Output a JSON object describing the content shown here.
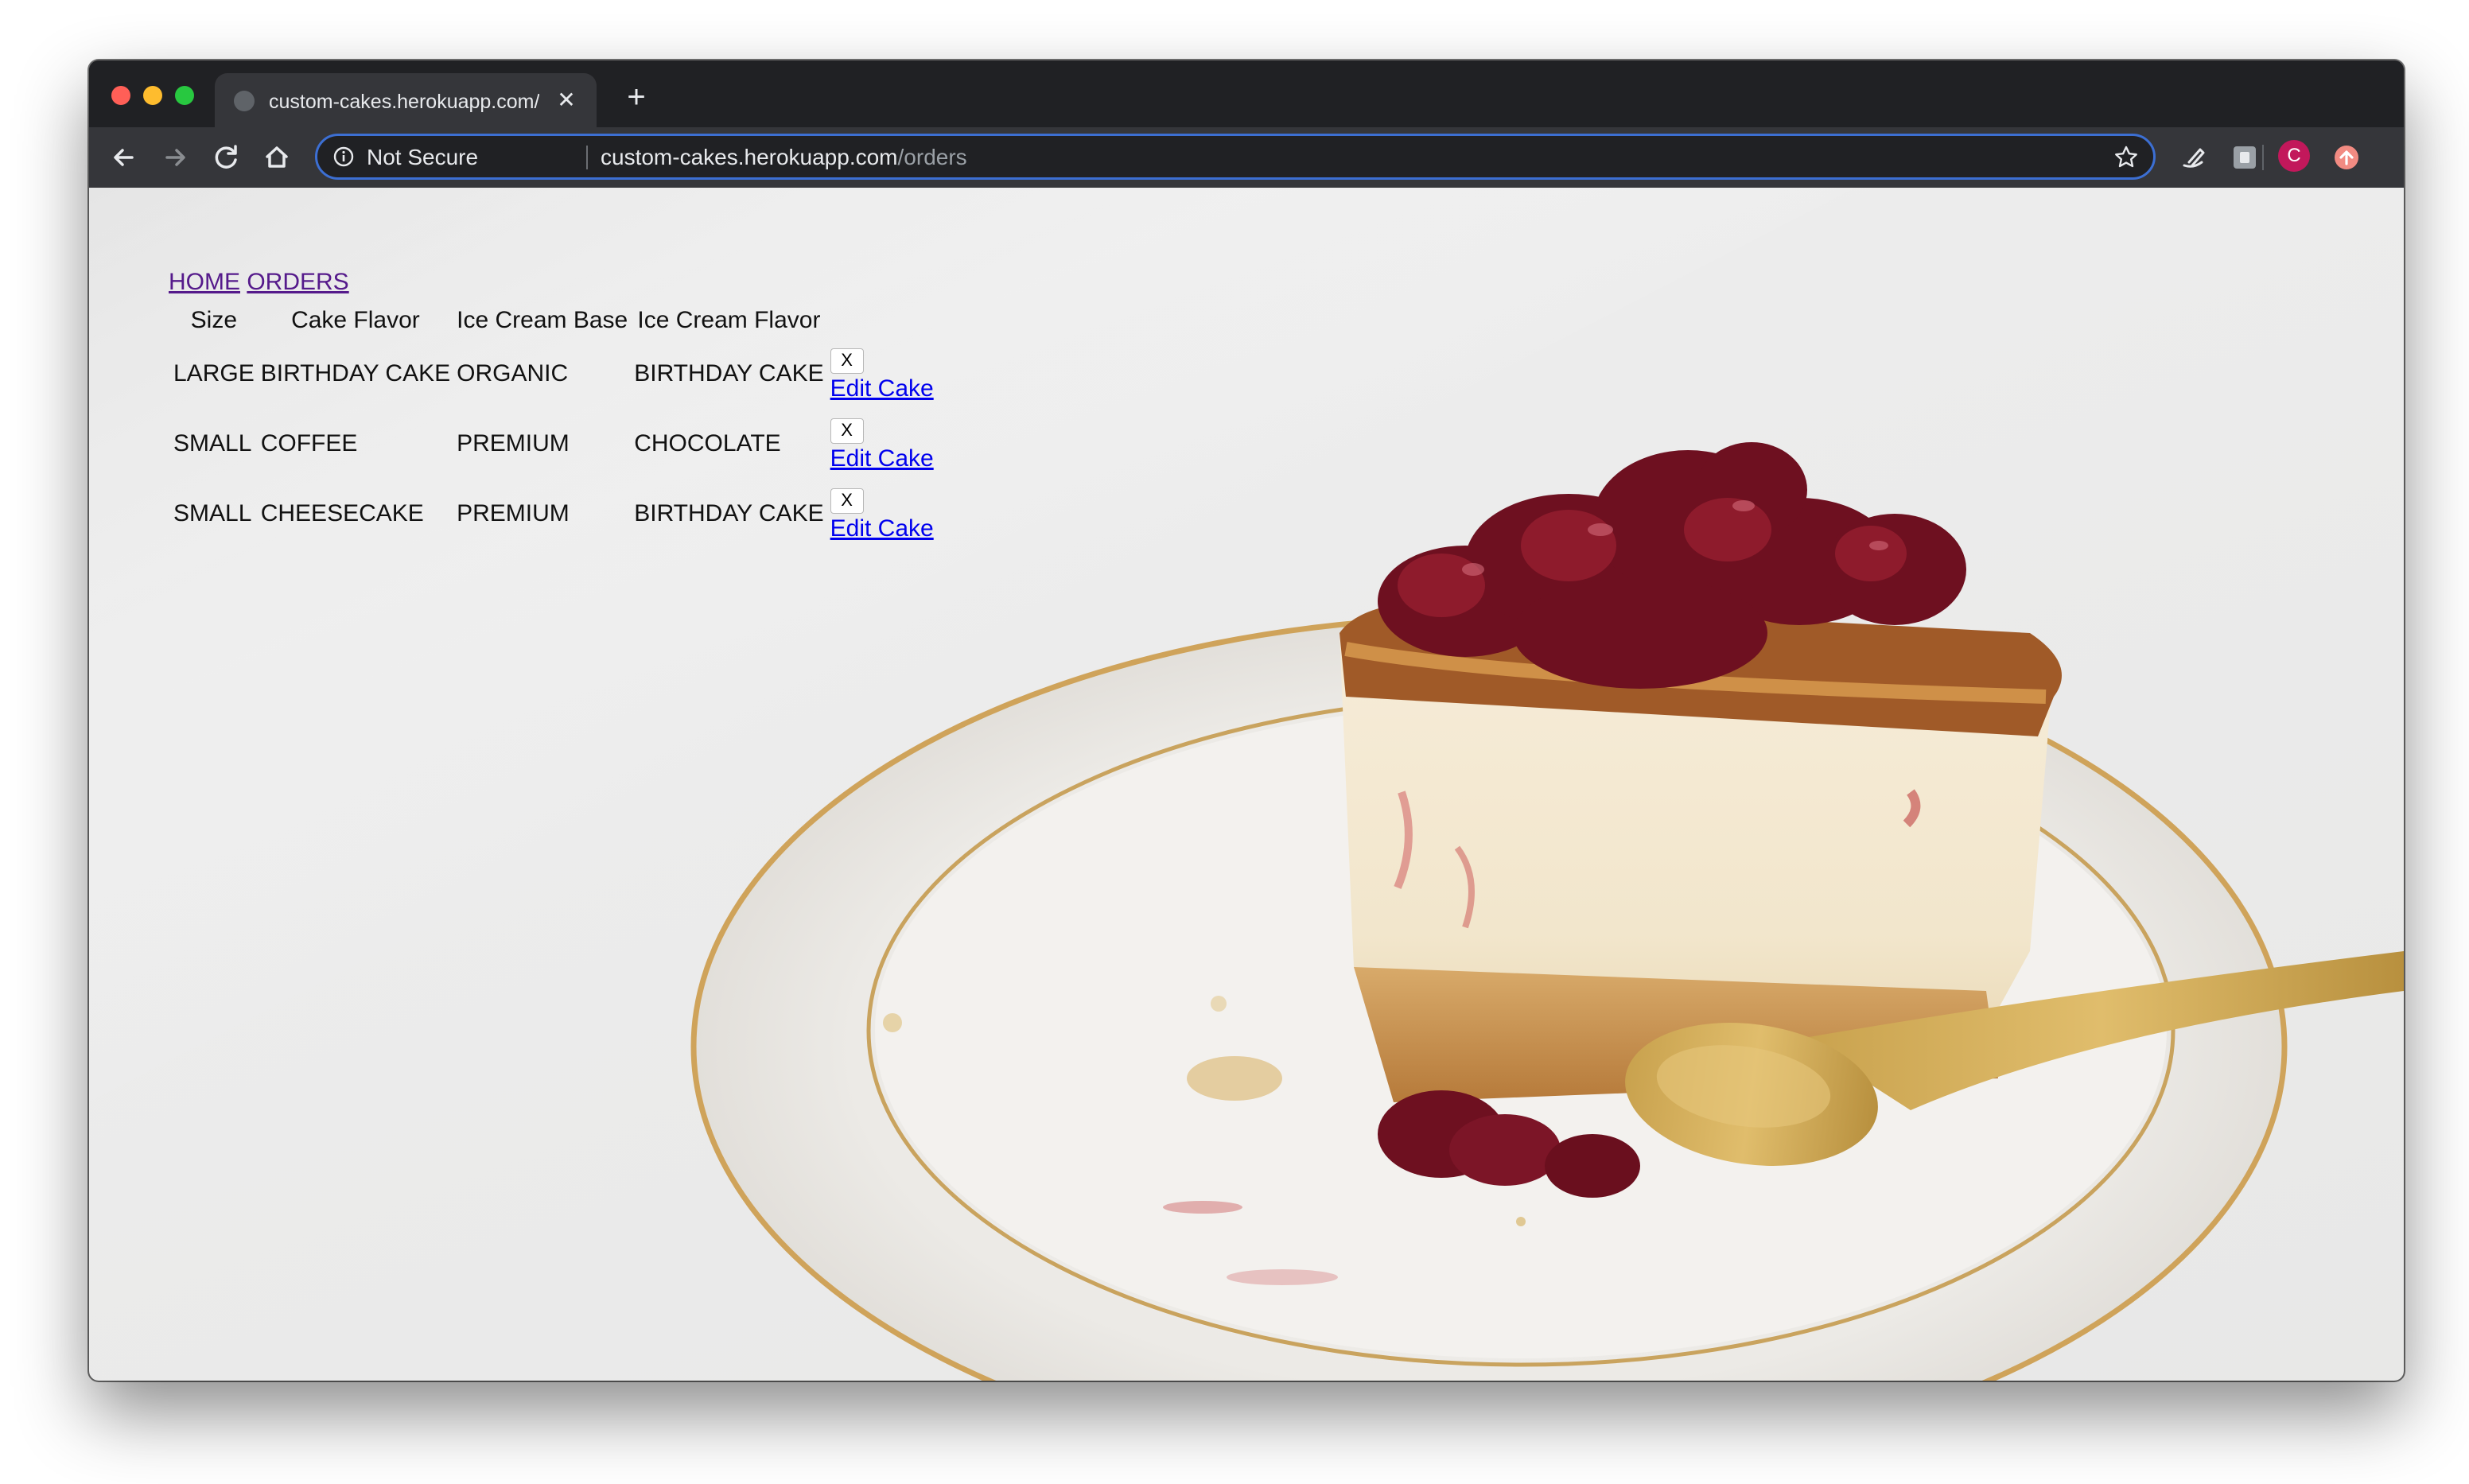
{
  "browser": {
    "tab_title": "custom-cakes.herokuapp.com/",
    "tab_close": "✕",
    "new_tab": "+",
    "security_label": "Not Secure",
    "url_host": "custom-cakes.herokuapp.com",
    "url_path": "/orders",
    "profile_initial": "C"
  },
  "nav": {
    "home": "HOME",
    "orders": "ORDERS"
  },
  "table": {
    "headers": [
      "Size",
      "Cake Flavor",
      "Ice Cream Base",
      "Ice Cream Flavor"
    ],
    "rows": [
      {
        "size": "LARGE",
        "cake_flavor": "BIRTHDAY CAKE",
        "ice_cream_base": "ORGANIC",
        "ice_cream_flavor": "BIRTHDAY CAKE"
      },
      {
        "size": "SMALL",
        "cake_flavor": "COFFEE",
        "ice_cream_base": "PREMIUM",
        "ice_cream_flavor": "CHOCOLATE"
      },
      {
        "size": "SMALL",
        "cake_flavor": "CHEESECAKE",
        "ice_cream_base": "PREMIUM",
        "ice_cream_flavor": "BIRTHDAY CAKE"
      }
    ],
    "delete_label": "X",
    "edit_label": "Edit Cake"
  }
}
